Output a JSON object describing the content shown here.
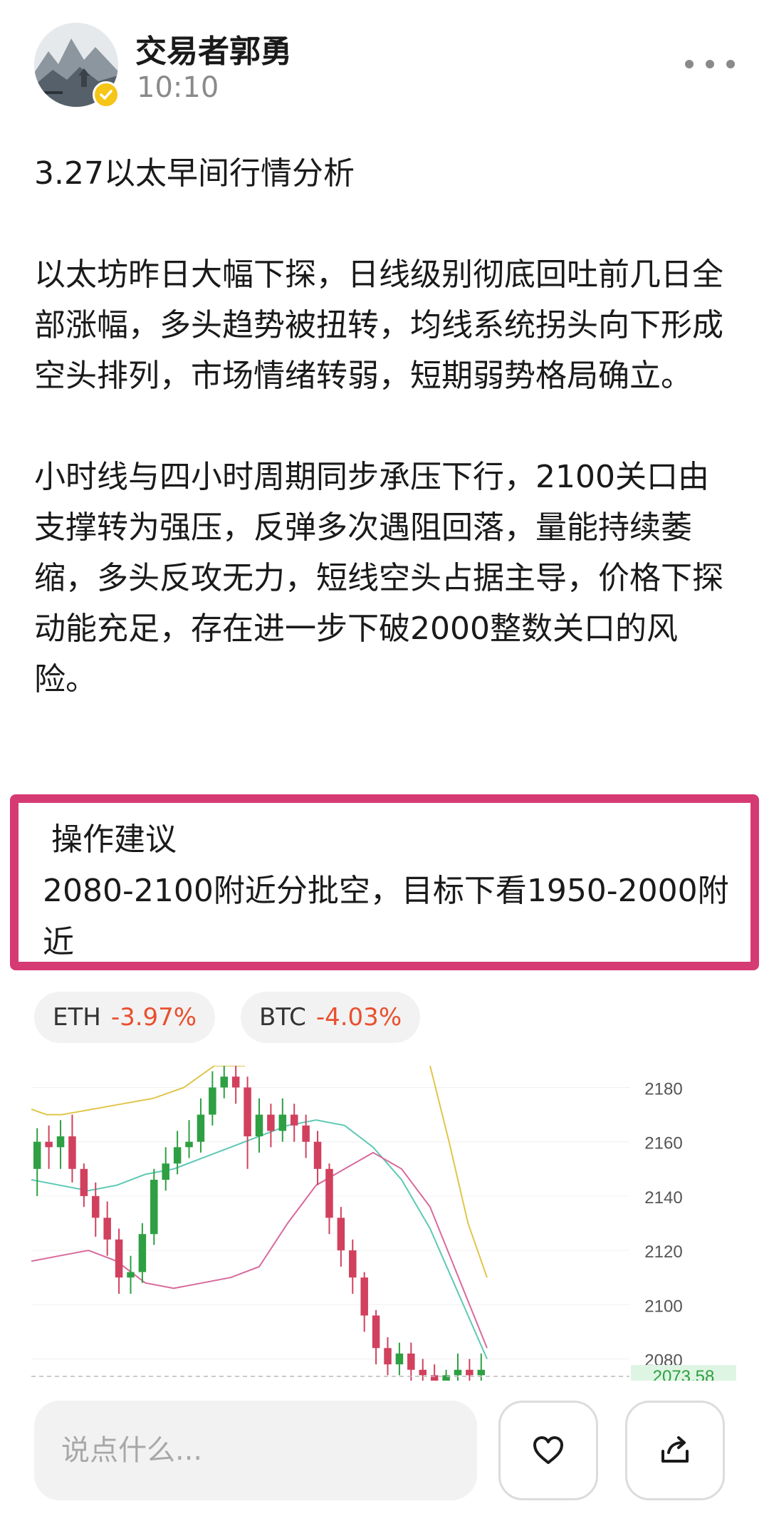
{
  "post": {
    "author": "交易者郭勇",
    "time": "10:10",
    "paragraphs": [
      "3.27以太早间行情分析",
      "以太坊昨日大幅下探，日线级别彻底回吐前几日全部涨幅，多头趋势被扭转，均线系统拐头向下形成空头排列，市场情绪转弱，短期弱势格局确立。",
      "小时线与四小时周期同步承压下行，2100关口由支撑转为强压，反弹多次遇阻回落，量能持续萎缩，多头反攻无力，短线空头占据主导，价格下探动能充足，存在进一步下破2000整数关口的风险。"
    ],
    "advice_title": "操作建议",
    "advice_text": "2080-2100附近分批空，目标下看1950-2000附近"
  },
  "tickers": [
    {
      "symbol": "ETH",
      "change": "-3.97%"
    },
    {
      "symbol": "BTC",
      "change": "-4.03%"
    }
  ],
  "bottom": {
    "comment_placeholder": "说点什么..."
  },
  "colors": {
    "accent_border": "#d63a72",
    "up": "#2ea043",
    "down": "#d1415e",
    "negative_change": "#e8502f",
    "current_price_bg": "#dff5e3"
  },
  "chart_data": {
    "type": "candlestick",
    "y_ticks": [
      2180,
      2160,
      2140,
      2120,
      2100,
      2080
    ],
    "ylim": [
      2072,
      2188
    ],
    "current_price": "2073.58",
    "candles": [
      [
        2150,
        2160,
        2165,
        2140
      ],
      [
        2160,
        2158,
        2166,
        2150
      ],
      [
        2158,
        2162,
        2168,
        2150
      ],
      [
        2162,
        2150,
        2170,
        2145
      ],
      [
        2150,
        2140,
        2152,
        2136
      ],
      [
        2140,
        2132,
        2145,
        2125
      ],
      [
        2132,
        2124,
        2138,
        2118
      ],
      [
        2124,
        2110,
        2128,
        2104
      ],
      [
        2110,
        2112,
        2118,
        2104
      ],
      [
        2112,
        2126,
        2130,
        2108
      ],
      [
        2126,
        2146,
        2150,
        2122
      ],
      [
        2146,
        2152,
        2158,
        2142
      ],
      [
        2152,
        2158,
        2164,
        2148
      ],
      [
        2158,
        2160,
        2168,
        2154
      ],
      [
        2160,
        2170,
        2176,
        2156
      ],
      [
        2170,
        2180,
        2186,
        2166
      ],
      [
        2180,
        2184,
        2188,
        2176
      ],
      [
        2184,
        2180,
        2188,
        2174
      ],
      [
        2180,
        2162,
        2184,
        2150
      ],
      [
        2162,
        2170,
        2176,
        2156
      ],
      [
        2170,
        2164,
        2174,
        2158
      ],
      [
        2164,
        2170,
        2176,
        2160
      ],
      [
        2170,
        2166,
        2174,
        2160
      ],
      [
        2166,
        2160,
        2170,
        2154
      ],
      [
        2160,
        2150,
        2164,
        2144
      ],
      [
        2150,
        2132,
        2152,
        2126
      ],
      [
        2132,
        2120,
        2136,
        2114
      ],
      [
        2120,
        2110,
        2124,
        2104
      ],
      [
        2110,
        2096,
        2112,
        2090
      ],
      [
        2096,
        2084,
        2098,
        2078
      ],
      [
        2084,
        2078,
        2088,
        2074
      ],
      [
        2078,
        2082,
        2086,
        2074
      ],
      [
        2082,
        2076,
        2086,
        2072
      ],
      [
        2076,
        2074,
        2080,
        2072
      ],
      [
        2074,
        2072,
        2078,
        2072
      ],
      [
        2072,
        2074,
        2076,
        2072
      ],
      [
        2074,
        2076,
        2082,
        2072
      ],
      [
        2076,
        2074,
        2080,
        2072
      ],
      [
        2074,
        2076,
        2082,
        2072
      ]
    ],
    "bands": {
      "upper": [
        2172,
        2170,
        2170,
        2171,
        2172,
        2173,
        2174,
        2175,
        2176,
        2178,
        2180,
        2184,
        2188,
        2188,
        2188
      ],
      "middle": [
        2146,
        2144,
        2142,
        2144,
        2148,
        2150,
        2154,
        2158,
        2162,
        2166,
        2168,
        2166,
        2158,
        2146,
        2128,
        2104,
        2080
      ],
      "lower": [
        2116,
        2118,
        2120,
        2116,
        2108,
        2106,
        2108,
        2110,
        2114,
        2130,
        2144,
        2150,
        2156,
        2150,
        2136,
        2110,
        2084
      ]
    },
    "ma_upper_drop": [
      2188,
      2160,
      2130,
      2110
    ]
  }
}
